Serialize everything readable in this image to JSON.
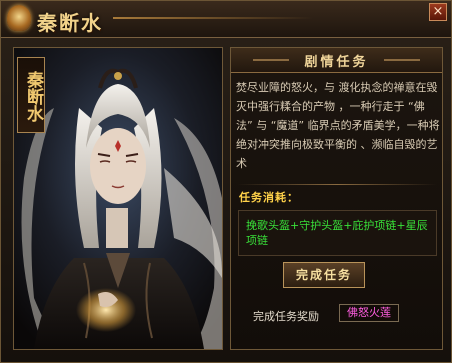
{
  "window": {
    "title": "秦断水",
    "close_glyph": "×",
    "close_icon": "close-icon"
  },
  "portrait": {
    "name_vertical": "秦断水",
    "colors": {
      "hair": "#e9e4dc",
      "robe": "#1c1714",
      "bg_glow": "#3b4a63"
    }
  },
  "quest": {
    "section_title": "剧情任务",
    "description": "焚尽业障的怒火，与 渡化执念的禅意在毁灭中强行糅合的产物 ，一种行走于 “佛法” 与 “魔道” 临界点的矛盾美学，一种将绝对冲突推向极致平衡的 、濒临自毁的艺术",
    "consume_label": "任务消耗：",
    "consume_items": "挽歌头盔+守护头盔+庇护项链+星辰项链",
    "complete_button": "完成任务",
    "reward_label": "完成任务奖励",
    "reward_item": "佛怒火莲"
  },
  "colors": {
    "accent_gold": "#f0d59a",
    "consume_label": "#ffd24a",
    "consume_items": "#39e039",
    "reward_item": "#ff5ee0"
  }
}
